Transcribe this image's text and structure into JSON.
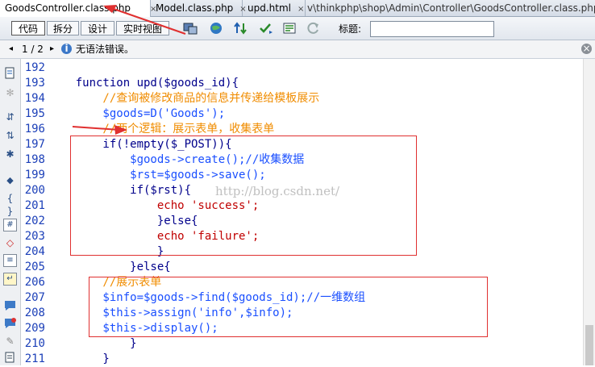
{
  "tabs": [
    {
      "label": "GoodsController.class.php",
      "active": true
    },
    {
      "label": "Model.class.php",
      "active": false
    },
    {
      "label": "upd.html",
      "active": false
    }
  ],
  "tab_close_glyph": "×",
  "file_path": "v\\thinkphp\\shop\\Admin\\Controller\\GoodsController.class.php",
  "toolbar": {
    "view_buttons": [
      {
        "label": "代码",
        "active": true
      },
      {
        "label": "拆分",
        "active": false
      },
      {
        "label": "设计",
        "active": false
      },
      {
        "label": "实时视图",
        "active": false
      }
    ],
    "icons": [
      "inspect-icon",
      "preview-globe-icon",
      "file-management-icon",
      "validate-icon",
      "visual-aids-icon",
      "refresh-icon"
    ],
    "title_label": "标题:",
    "title_value": ""
  },
  "status": {
    "page_indicator": "1 / 2",
    "message": "无语法错误。",
    "prev_glyph": "◂",
    "next_glyph": "▸",
    "close_glyph": "×"
  },
  "sidebar_icons": [
    "open-documents-icon",
    "show-code-navigator-icon",
    "collapse-full-tag-icon",
    "collapse-selection-icon",
    "expand-all-icon",
    "select-parent-tag-icon",
    "balance-braces-icon",
    "line-numbers-icon",
    "highlight-invalid-code-icon",
    "syntax-coloring-icon",
    "word-wrap-icon",
    "apply-comment-icon",
    "remove-comment-icon",
    "wrap-tag-icon",
    "recent-snippets-icon"
  ],
  "code": {
    "line_numbers": [
      "192",
      "193",
      "194",
      "195",
      "196",
      "197",
      "198",
      "199",
      "200",
      "201",
      "202",
      "203",
      "204",
      "205",
      "206",
      "207",
      "208",
      "209",
      "210",
      "211"
    ],
    "lines": [
      "",
      "    function upd($goods_id){",
      "        //查询被修改商品的信息并传递给模板展示",
      "        $goods=D('Goods');",
      "        //两个逻辑：展示表单，收集表单",
      "        if(!empty($_POST)){",
      "            $goods->create();//收集数据",
      "            $rst=$goods->save();",
      "            if($rst){",
      "                echo 'success';",
      "                }else{",
      "                echo 'failure';",
      "                }",
      "            }else{",
      "        //展示表单",
      "        $info=$goods->find($goods_id);//一维数组",
      "        $this->assign('info',$info);",
      "        $this->display();",
      "            }",
      "        }"
    ]
  },
  "watermark": "http://blog.csdn.net/",
  "colors": {
    "line_number": "#1b3fb8",
    "keyword": "#00008b",
    "variable": "#1a4fff",
    "string": "#c00000",
    "comment": "#f08c00",
    "annotation_red": "#e03030"
  }
}
